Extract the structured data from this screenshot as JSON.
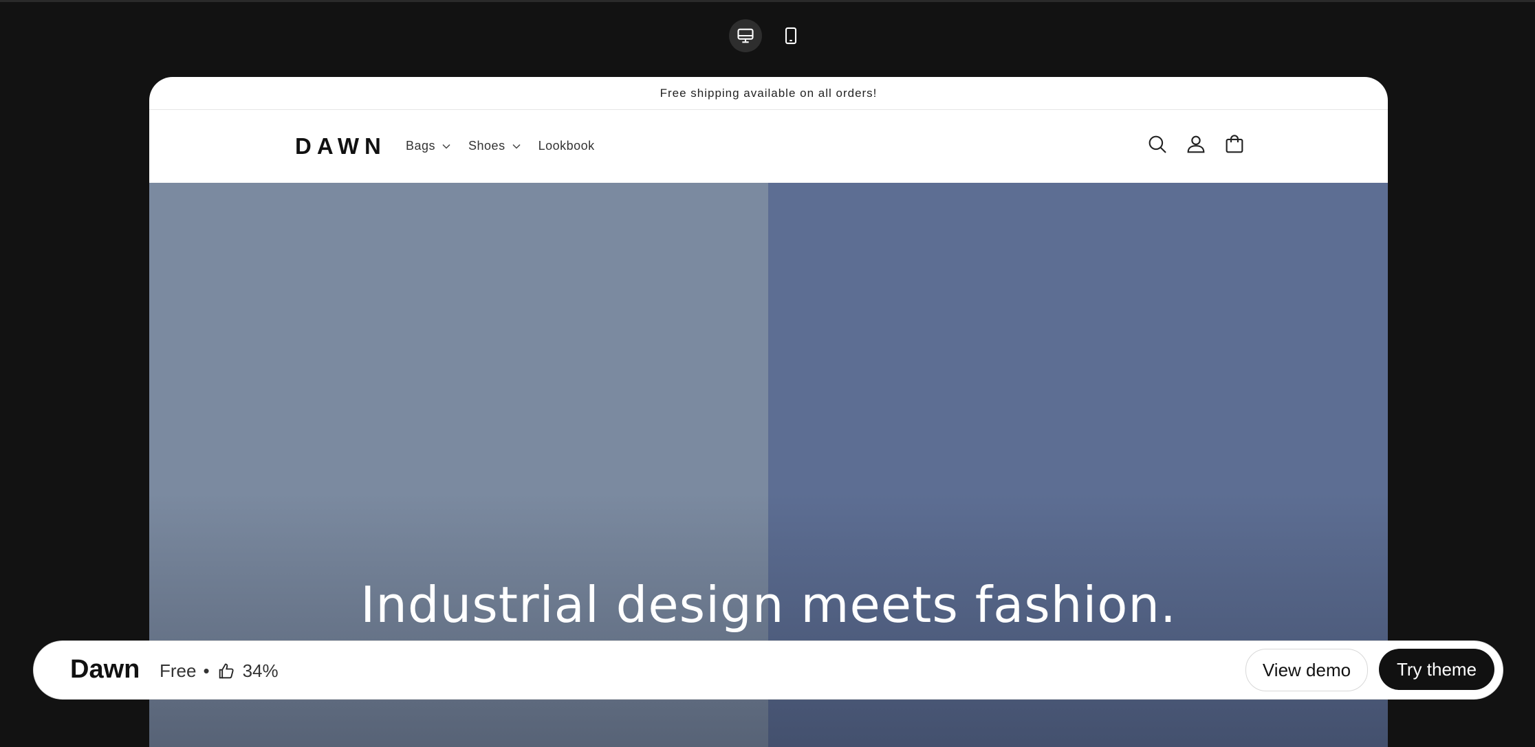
{
  "device_toggle": {
    "desktop_icon": "desktop-icon",
    "mobile_icon": "mobile-icon",
    "active": "desktop"
  },
  "store": {
    "announcement": "Free shipping available on all orders!",
    "logo": "DAWN",
    "nav": [
      {
        "label": "Bags",
        "has_dropdown": true
      },
      {
        "label": "Shoes",
        "has_dropdown": true
      },
      {
        "label": "Lookbook",
        "has_dropdown": false
      }
    ],
    "header_icons": [
      "search-icon",
      "account-icon",
      "cart-icon"
    ],
    "hero": {
      "title": "Industrial design meets fashion.",
      "colors": {
        "left": "#7b8aa0",
        "right": "#5d6e93"
      }
    }
  },
  "theme_bar": {
    "name": "Dawn",
    "price": "Free",
    "separator": "•",
    "rating": "34%",
    "view_demo": "View demo",
    "try_theme": "Try theme"
  },
  "colors": {
    "page_background": "#121212",
    "button_dark": "#111111"
  }
}
